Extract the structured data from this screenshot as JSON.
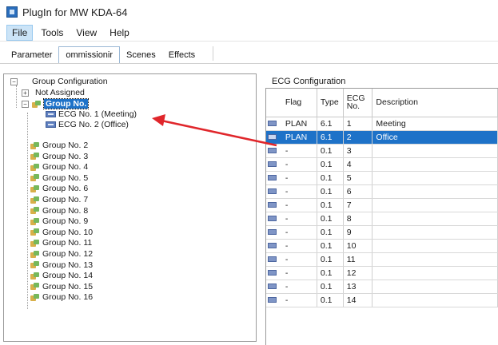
{
  "window": {
    "title": "PlugIn for MW KDA-64"
  },
  "menu": [
    "File",
    "Tools",
    "View",
    "Help"
  ],
  "tabs": [
    "Parameter",
    "ommissionir",
    "Scenes",
    "Effects"
  ],
  "tree": {
    "root": "Group Configuration",
    "not_assigned": "Not Assigned",
    "selected_group": "Group No.",
    "ecg_children": [
      "ECG No. 1 (Meeting)",
      "ECG No. 2 (Office)"
    ],
    "groups": [
      "Group No. 2",
      "Group No. 3",
      "Group No. 4",
      "Group No. 5",
      "Group No. 6",
      "Group No. 7",
      "Group No. 8",
      "Group No. 9",
      "Group No. 10",
      "Group No. 11",
      "Group No. 12",
      "Group No. 13",
      "Group No. 14",
      "Group No. 15",
      "Group No. 16"
    ],
    "expander_collapsed": "+",
    "expander_expanded": "−"
  },
  "ecg_panel": {
    "title": "ECG Configuration",
    "columns": {
      "flag": "Flag",
      "type": "Type",
      "ecg_no_1": "ECG",
      "ecg_no_2": "No.",
      "description": "Description"
    },
    "rows": [
      {
        "flag": "PLAN",
        "type": "6.1",
        "no": "1",
        "description": "Meeting",
        "selected": false
      },
      {
        "flag": "PLAN",
        "type": "6.1",
        "no": "2",
        "description": "Office",
        "selected": true
      },
      {
        "flag": "-",
        "type": "0.1",
        "no": "3",
        "description": "",
        "selected": false
      },
      {
        "flag": "-",
        "type": "0.1",
        "no": "4",
        "description": "",
        "selected": false
      },
      {
        "flag": "-",
        "type": "0.1",
        "no": "5",
        "description": "",
        "selected": false
      },
      {
        "flag": "-",
        "type": "0.1",
        "no": "6",
        "description": "",
        "selected": false
      },
      {
        "flag": "-",
        "type": "0.1",
        "no": "7",
        "description": "",
        "selected": false
      },
      {
        "flag": "-",
        "type": "0.1",
        "no": "8",
        "description": "",
        "selected": false
      },
      {
        "flag": "-",
        "type": "0.1",
        "no": "9",
        "description": "",
        "selected": false
      },
      {
        "flag": "-",
        "type": "0.1",
        "no": "10",
        "description": "",
        "selected": false
      },
      {
        "flag": "-",
        "type": "0.1",
        "no": "11",
        "description": "",
        "selected": false
      },
      {
        "flag": "-",
        "type": "0.1",
        "no": "12",
        "description": "",
        "selected": false
      },
      {
        "flag": "-",
        "type": "0.1",
        "no": "13",
        "description": "",
        "selected": false
      },
      {
        "flag": "-",
        "type": "0.1",
        "no": "14",
        "description": "",
        "selected": false
      }
    ]
  },
  "colors": {
    "selection": "#1e72c8",
    "annotation_arrow": "#e0262b"
  }
}
